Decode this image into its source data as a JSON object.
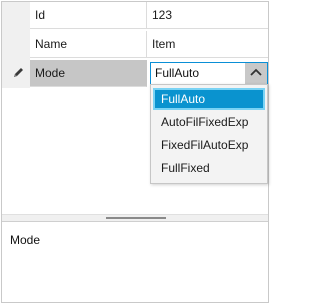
{
  "properties": [
    {
      "name": "Id",
      "value": "123"
    },
    {
      "name": "Name",
      "value": "Item"
    },
    {
      "name": "Mode",
      "value": "FullAuto",
      "selected": true,
      "icon": "pencil-icon"
    }
  ],
  "editor": {
    "current_value": "FullAuto",
    "options": [
      "FullAuto",
      "AutoFilFixedExp",
      "FixedFilAutoExp",
      "FullFixed"
    ],
    "highlighted_option": "FullAuto",
    "toggle_icon": "chevron-up-icon"
  },
  "description": {
    "title": "Mode"
  },
  "colors": {
    "accent": "#0A93CF",
    "selection_gray": "#C6C6C6",
    "border": "#C9C9C9"
  }
}
